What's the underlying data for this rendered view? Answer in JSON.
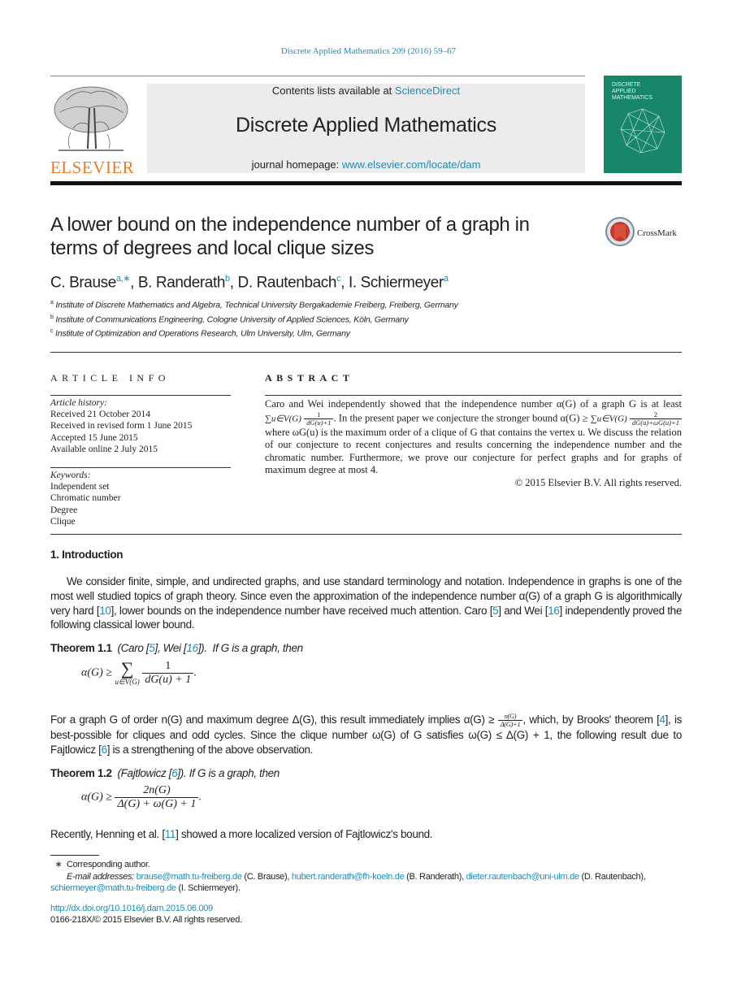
{
  "header": {
    "journal_ref": "Discrete Applied Mathematics 209 (2016) 59–67",
    "contents_prefix": "Contents lists available at ",
    "contents_link": "ScienceDirect",
    "journal_title": "Discrete Applied Mathematics",
    "homepage_prefix": "journal homepage: ",
    "homepage_link": "www.elsevier.com/locate/dam",
    "publisher_logo": "ELSEVIER",
    "cover_title": "DISCRETE\nAPPLIED\nMATHEMATICS",
    "crossmark_label": "CrossMark"
  },
  "paper": {
    "title": "A lower bound on the independence number of a graph in terms of degrees and local clique sizes",
    "authors": [
      {
        "name": "C. Brause",
        "sup": "a,∗"
      },
      {
        "name": "B. Randerath",
        "sup": "b"
      },
      {
        "name": "D. Rautenbach",
        "sup": "c"
      },
      {
        "name": "I. Schiermeyer",
        "sup": "a"
      }
    ],
    "affiliations": [
      {
        "key": "a",
        "text": "Institute of Discrete Mathematics and Algebra, Technical University Bergakademie Freiberg, Freiberg, Germany"
      },
      {
        "key": "b",
        "text": "Institute of Communications Engineering, Cologne University of Applied Sciences, Köln, Germany"
      },
      {
        "key": "c",
        "text": "Institute of Optimization and Operations Research, Ulm University, Ulm, Germany"
      }
    ]
  },
  "article_info": {
    "heading": "ARTICLE INFO",
    "history_label": "Article history:",
    "history": [
      "Received 21 October 2014",
      "Received in revised form 1 June 2015",
      "Accepted 15 June 2015",
      "Available online 2 July 2015"
    ],
    "keywords_label": "Keywords:",
    "keywords": [
      "Independent set",
      "Chromatic number",
      "Degree",
      "Clique"
    ]
  },
  "abstract": {
    "heading": "ABSTRACT",
    "p1": "Caro and Wei independently showed that the independence number α(G) of a graph G is at least",
    "sum1": "∑u∈V(G)",
    "frac1_num": "1",
    "frac1_den": "dG(u)+1",
    "p2": ". In the present paper we conjecture the stronger bound α(G) ≥",
    "sum2": "∑u∈V(G)",
    "frac2_num": "2",
    "frac2_den": "dG(u)+ωG(u)+1",
    "p3": " where ωG(u) is the maximum order of a clique of G that contains the vertex u. We discuss the relation of our conjecture to recent conjectures and results concerning the independence number and the chromatic number. Furthermore, we prove our conjecture for perfect graphs and for graphs of maximum degree at most 4.",
    "copyright": "© 2015 Elsevier B.V. All rights reserved."
  },
  "intro": {
    "heading": "1. Introduction",
    "p1a": "We consider finite, simple, and undirected graphs, and use standard terminology and notation. Independence in graphs is one of the most well studied topics of graph theory. Since even the approximation of the independence number α(G) of a graph G is algorithmically very hard [",
    "ref10": "10",
    "p1b": "], lower bounds on the independence number have received much attention. Caro [",
    "ref5": "5",
    "p1c": "] and Wei [",
    "ref16": "16",
    "p1d": "] independently proved the following classical lower bound.",
    "thm1_label": "Theorem 1.1",
    "thm1_attr_a": "(Caro [",
    "thm1_attr_b": "], Wei [",
    "thm1_attr_c": "]).",
    "thm1_stmt": "If G is a graph, then",
    "eq1_lhs": "α(G) ≥",
    "eq1_sum": "∑",
    "eq1_sub": "u∈V(G)",
    "eq1_num": "1",
    "eq1_den": "dG(u) + 1",
    "p2a": "For a graph G of order n(G) and maximum degree Δ(G), this result immediately implies α(G) ≥",
    "p2_frac_num": "n(G)",
    "p2_frac_den": "Δ(G)+1",
    "p2b": ", which, by Brooks' theorem [",
    "ref4": "4",
    "p2c": "], is best-possible for cliques and odd cycles. Since the clique number ω(G) of G satisfies ω(G) ≤ Δ(G) + 1, the following result due to Fajtlowicz [",
    "ref6": "6",
    "p2d": "] is a strengthening of the above observation.",
    "thm2_label": "Theorem 1.2",
    "thm2_attr_a": "(Fajtlowicz [",
    "thm2_attr_b": "]).",
    "thm2_stmt": "If G is a graph, then",
    "eq2_lhs": "α(G) ≥",
    "eq2_num": "2n(G)",
    "eq2_den": "Δ(G) + ω(G) + 1",
    "p3a": "Recently, Henning et al. [",
    "ref11": "11",
    "p3b": "] showed a more localized version of Fajtlowicz's bound."
  },
  "footnotes": {
    "star": "∗",
    "corresponding": "Corresponding author.",
    "email_label": "E-mail addresses: ",
    "emails": [
      {
        "addr": "brause@math.tu-freiberg.de",
        "who": " (C. Brause), "
      },
      {
        "addr": "hubert.randerath@fh-koeln.de",
        "who": " (B. Randerath), "
      },
      {
        "addr": "dieter.rautenbach@uni-ulm.de",
        "who": " (D. Rautenbach), "
      },
      {
        "addr": "schiermeyer@math.tu-freiberg.de",
        "who": " (I. Schiermeyer)."
      }
    ],
    "doi": "http://dx.doi.org/10.1016/j.dam.2015.06.009",
    "issn_copyright": "0166-218X/© 2015 Elsevier B.V. All rights reserved."
  },
  "colors": {
    "link": "#1f8bb8",
    "elsevier_orange": "#f07a21",
    "cover_green": "#17866b",
    "banner_gray": "#ececec"
  }
}
